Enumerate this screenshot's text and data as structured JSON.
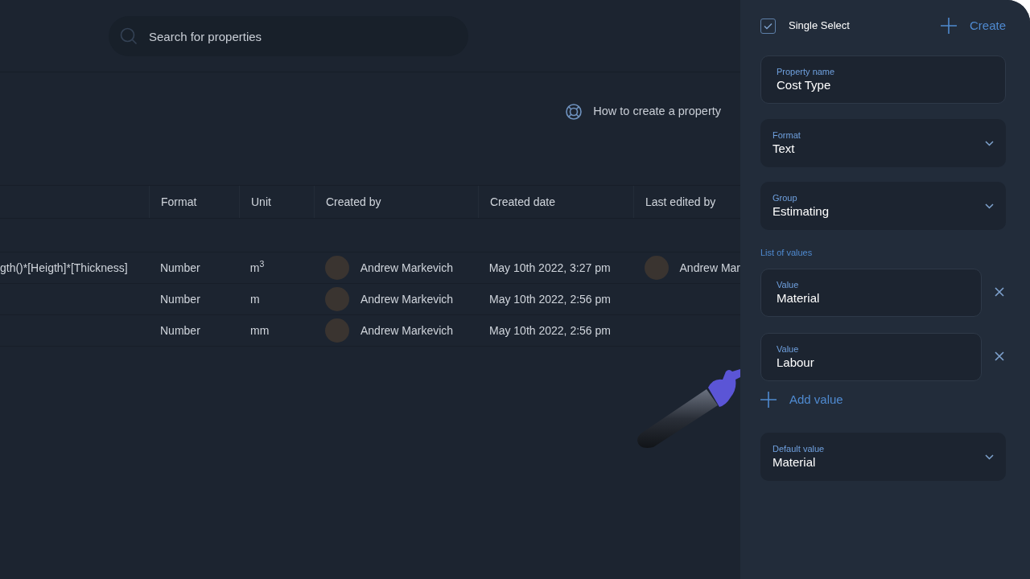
{
  "search": {
    "placeholder": "Search for properties"
  },
  "help_link": "How to create a property",
  "table": {
    "columns": [
      "Format",
      "Unit",
      "Created by",
      "Created date",
      "Last edited by"
    ],
    "rows": [
      {
        "column_1": "gth()*[Heigth]*[Thickness]",
        "format": "Number",
        "unit": "m$^{3}$",
        "created_by": "Andrew Markevich",
        "created_date": "May 10th 2022, 3:27 pm",
        "last_edited_by": "Andrew Mar"
      },
      {
        "format": "Number",
        "unit": "m",
        "created_by": "Andrew Markevich",
        "created_date": "May 10th 2022, 2:56 pm"
      },
      {
        "format": "Number",
        "unit": "mm",
        "created_by": "Andrew Markevich",
        "created_date": "May 10th 2022, 2:56 pm"
      }
    ]
  },
  "panel": {
    "single_select": {
      "label": "Single Select",
      "checked": true
    },
    "create_button": "Create",
    "property_name": {
      "label": "Property name",
      "value": "Cost Type"
    },
    "format": {
      "label": "Format",
      "value": "Text"
    },
    "group": {
      "label": "Group",
      "value": "Estimating"
    },
    "list_label": "List of values",
    "values": [
      {
        "label": "Value",
        "value": "Material"
      },
      {
        "label": "Value",
        "value": "Labour"
      }
    ],
    "add_value": "Add value",
    "default_value": {
      "label": "Default value",
      "value": "Material"
    }
  }
}
